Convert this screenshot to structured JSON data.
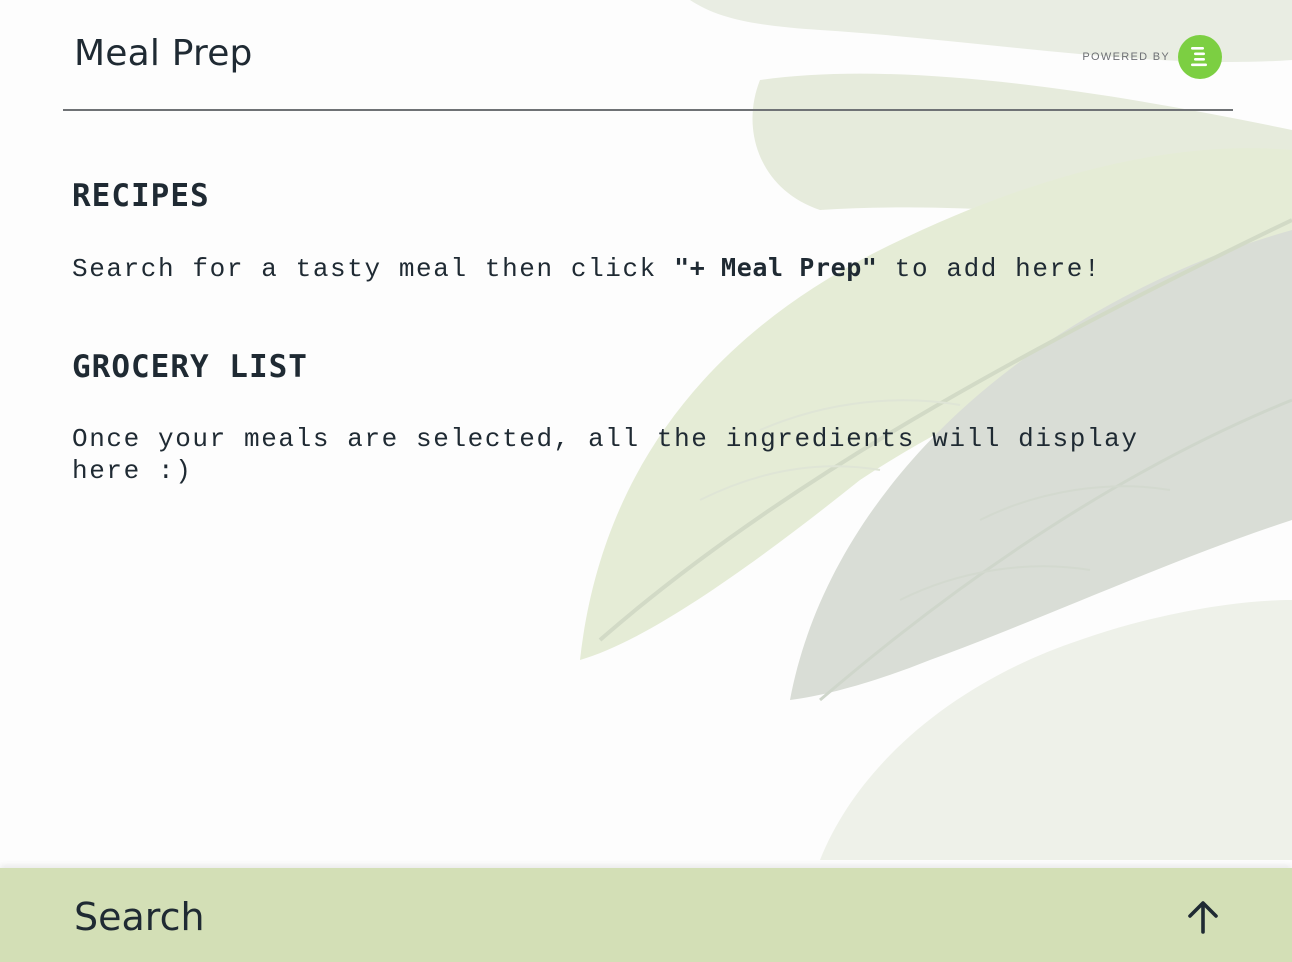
{
  "header": {
    "title": "Meal Prep",
    "powered_by": "POWERED BY",
    "logo_icon": "edamam-logo-icon",
    "logo_color": "#7ccf42"
  },
  "recipes": {
    "title": "RECIPES",
    "text_before": "Search for a tasty meal then click ",
    "text_bold": "\"+ Meal Prep\"",
    "text_after": " to add here!"
  },
  "grocery": {
    "title": "GROCERY LIST",
    "text": "Once your meals are selected, all the ingredients will display here :)"
  },
  "search_bar": {
    "label": "Search",
    "expand_icon": "arrow-up-icon",
    "background": "#d3dfb6"
  },
  "background": {
    "image": "leaves-background",
    "tint": "#e6ecd8"
  }
}
